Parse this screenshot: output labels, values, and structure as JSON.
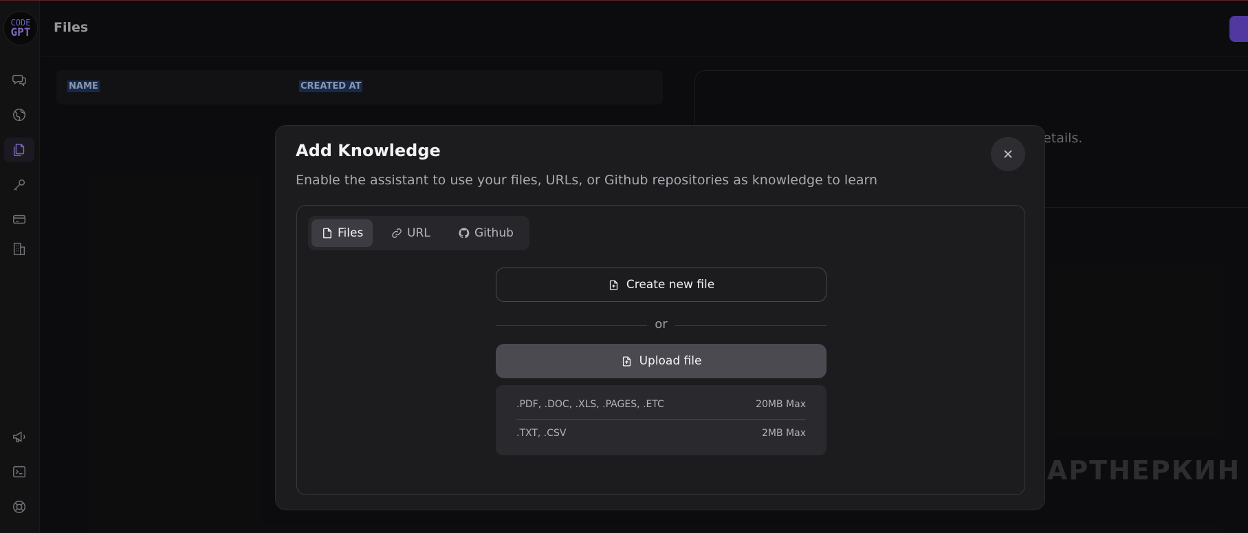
{
  "app": {
    "logo_line1": "CODE",
    "logo_line2": "GPT"
  },
  "header": {
    "title": "Files"
  },
  "sidebar": {
    "items": [
      {
        "icon": "chat-icon"
      },
      {
        "icon": "globe-icon"
      },
      {
        "icon": "files-icon",
        "active": true
      },
      {
        "icon": "key-icon"
      },
      {
        "icon": "credit-card-icon"
      },
      {
        "icon": "building-icon"
      },
      {
        "icon": "megaphone-icon"
      },
      {
        "icon": "terminal-icon"
      },
      {
        "icon": "help-lifebuoy-icon"
      }
    ]
  },
  "table": {
    "columns": [
      "NAME",
      "CREATED AT"
    ]
  },
  "details": {
    "text": "details."
  },
  "watermark": {
    "text": "ПАРТНЕРКИН"
  },
  "modal": {
    "title": "Add Knowledge",
    "subtitle": "Enable the assistant to use your files, URLs, or Github repositories as knowledge to learn",
    "tabs": [
      {
        "label": "Files",
        "icon": "file-icon",
        "active": true
      },
      {
        "label": "URL",
        "icon": "link-icon"
      },
      {
        "label": "Github",
        "icon": "github-icon"
      }
    ],
    "create_label": "Create new file",
    "or_label": "or",
    "upload_label": "Upload file",
    "limits": [
      {
        "types": ".PDF, .DOC, .XLS, .PAGES, .ETC",
        "max": "20MB Max"
      },
      {
        "types": ".TXT, .CSV",
        "max": "2MB Max"
      }
    ]
  },
  "colors": {
    "accent": "#a78bfa",
    "background": "#111113",
    "modal": "#1c1c1f"
  }
}
